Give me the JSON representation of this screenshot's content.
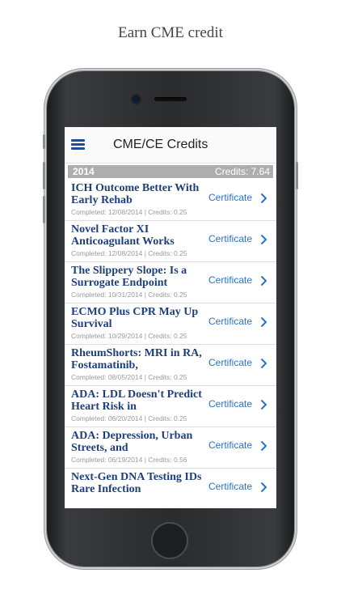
{
  "caption": "Earn CME credit",
  "navbar": {
    "title": "CME/CE Credits",
    "menu_icon": "hamburger-menu-icon"
  },
  "section": {
    "year": "2014",
    "credits": "Credits: 7.64"
  },
  "certificate_label": "Certificate",
  "accent_color": "#1d3f7a",
  "link_color": "#2a73c6",
  "items": [
    {
      "title": "ICH Outcome Better With Early Rehab",
      "meta": "Completed: 12/08/2014 | Credits: 0.25"
    },
    {
      "title": "Novel Factor XI Anticoagulant Works",
      "meta": "Completed: 12/08/2014 | Credits: 0.25"
    },
    {
      "title": "The Slippery Slope: Is a Surrogate Endpoint",
      "meta": "Completed: 10/31/2014 | Credits: 0.25"
    },
    {
      "title": "ECMO Plus CPR May Up Survival",
      "meta": "Completed: 10/29/2014 | Credits: 0.25"
    },
    {
      "title": "RheumShorts: MRI in RA, Fostamatinib,",
      "meta": "Completed: 08/05/2014 | Credits: 0.25"
    },
    {
      "title": "ADA: LDL Doesn't Predict Heart Risk in",
      "meta": "Completed: 06/20/2014 | Credits: 0.25"
    },
    {
      "title": "ADA: Depression, Urban Streets, and",
      "meta": "Completed: 06/19/2014 | Credits: 0.56"
    },
    {
      "title": "Next-Gen DNA Testing IDs Rare Infection",
      "meta": ""
    }
  ]
}
